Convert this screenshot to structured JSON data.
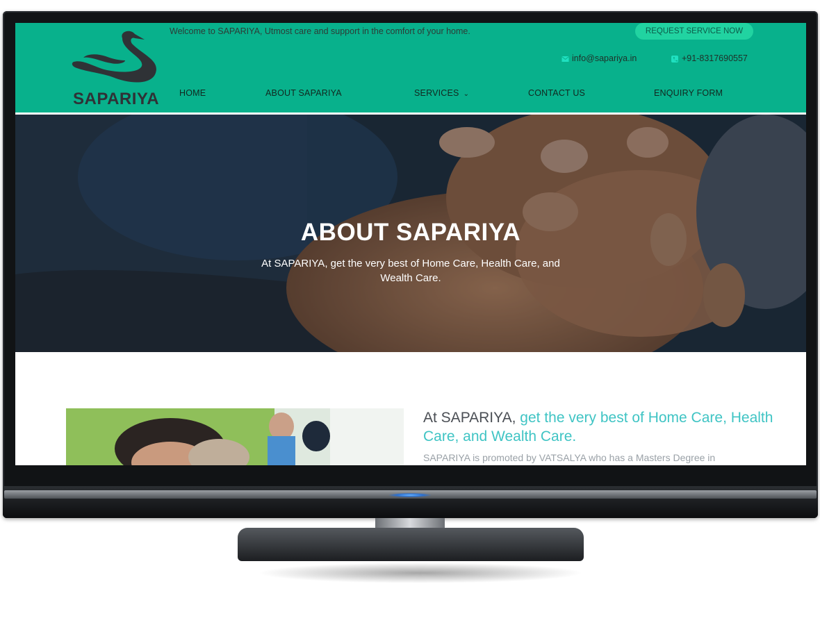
{
  "topbar": {
    "welcome_text": "Welcome to SAPARIYA, Utmost care and support in the comfort of your home.",
    "request_button": "REQUEST SERVICE NOW",
    "email": "info@sapariya.in",
    "phone": "+91-8317690557"
  },
  "brand": {
    "name": "SAPARIYA",
    "color": "#08b18c"
  },
  "nav": [
    {
      "label": "HOME"
    },
    {
      "label": "ABOUT SAPARIYA"
    },
    {
      "label": "SERVICES"
    },
    {
      "label": "CONTACT US"
    },
    {
      "label": "ENQUIRY FORM"
    }
  ],
  "hero": {
    "title": "ABOUT SAPARIYA",
    "subtitle": "At SAPARIYA, get the very best of Home Care, Health Care, and Wealth Care."
  },
  "intro": {
    "lead": "At SAPARIYA,",
    "highlight": " get the very best of Home Care, Health Care, and Wealth Care.",
    "paragraph": "SAPARIYA is promoted by VATSALYA who has a Masters Degree in"
  },
  "icons": {
    "email": "envelope-icon",
    "phone": "phone-icon",
    "services_dropdown": "chevron-down-icon"
  },
  "colors": {
    "accent": "#08b18c",
    "button": "#21d3a1",
    "highlight": "#3fc4c4"
  }
}
